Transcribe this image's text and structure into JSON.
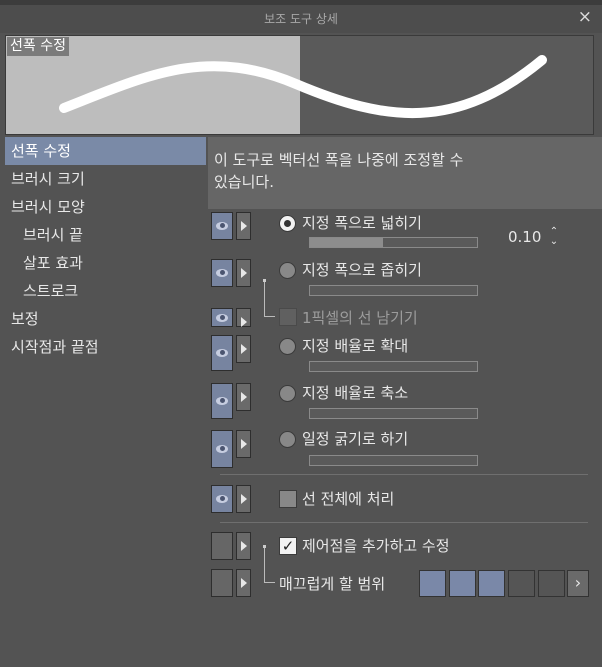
{
  "window": {
    "title": "보조 도구 상세",
    "close_icon": "×"
  },
  "preview": {
    "label": "선폭 수정"
  },
  "categories": [
    {
      "label": "선폭 수정",
      "active": true
    },
    {
      "label": "브러시 크기"
    },
    {
      "label": "브러시 모양"
    },
    {
      "label": "브러시 끝",
      "sub": true
    },
    {
      "label": "살포 효과",
      "sub": true
    },
    {
      "label": "스트로크",
      "sub": true
    },
    {
      "label": "보정"
    },
    {
      "label": "시작점과 끝점"
    }
  ],
  "description": {
    "line1": "이 도구로 벡터선 폭을 나중에 조정할 수",
    "line2": "있습니다."
  },
  "options": {
    "widen": {
      "label": "지정 폭으로 넓히기",
      "value": "0.10",
      "level": 0.42,
      "checked": true
    },
    "narrow": {
      "label": "지정 폭으로 좁히기"
    },
    "leave_pixel": {
      "label": "1픽셀의 선 남기기"
    },
    "scale_up": {
      "label": "지정 배율로 확대"
    },
    "scale_down": {
      "label": "지정 배율로 축소"
    },
    "fixed": {
      "label": "일정 굵기로 하기"
    },
    "whole_line": {
      "label": "선 전체에 처리"
    },
    "add_control": {
      "label": "제어점을 추가하고 수정",
      "checked_glyph": "✓"
    },
    "smooth_range": {
      "label": "매끄럽게 할 범위",
      "next_glyph": "›"
    }
  },
  "spin": {
    "up": "⌃",
    "down": "⌄"
  },
  "colors": {
    "accent": "#7a88a8",
    "panel": "#535353",
    "preview_light": "#bdbdbd"
  }
}
